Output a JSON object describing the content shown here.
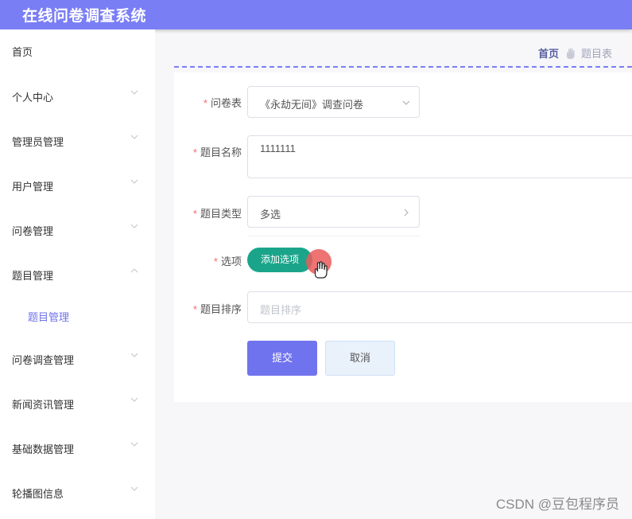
{
  "app": {
    "title": "在线问卷调查系统"
  },
  "sidebar": {
    "items": [
      {
        "label": "首页",
        "has_chevron": false
      },
      {
        "label": "个人中心",
        "has_chevron": true,
        "chevron": "down"
      },
      {
        "label": "管理员管理",
        "has_chevron": true,
        "chevron": "down"
      },
      {
        "label": "用户管理",
        "has_chevron": true,
        "chevron": "down"
      },
      {
        "label": "问卷管理",
        "has_chevron": true,
        "chevron": "down"
      },
      {
        "label": "题目管理",
        "has_chevron": true,
        "chevron": "up",
        "expanded": true
      },
      {
        "label": "问卷调查管理",
        "has_chevron": true,
        "chevron": "down"
      },
      {
        "label": "新闻资讯管理",
        "has_chevron": true,
        "chevron": "down"
      },
      {
        "label": "基础数据管理",
        "has_chevron": true,
        "chevron": "down"
      },
      {
        "label": "轮播图信息",
        "has_chevron": true,
        "chevron": "down"
      }
    ],
    "subitem": {
      "label": "题目管理",
      "active": true
    }
  },
  "breadcrumb": {
    "home": "首页",
    "current": "题目表"
  },
  "form": {
    "survey": {
      "label": "问卷表",
      "value": "《永劫无间》调查问卷"
    },
    "name": {
      "label": "题目名称",
      "value": "1111111"
    },
    "type": {
      "label": "题目类型",
      "value": "多选"
    },
    "options": {
      "label": "选项",
      "add_label": "添加选项"
    },
    "order": {
      "label": "题目排序",
      "placeholder": "题目排序"
    },
    "required_mark": "*"
  },
  "actions": {
    "submit": "提交",
    "cancel": "取消"
  },
  "watermark": "CSDN @豆包程序员",
  "colors": {
    "primary": "#7a7ef5",
    "add_button": "#1aa58a",
    "required": "#f56c6c"
  }
}
